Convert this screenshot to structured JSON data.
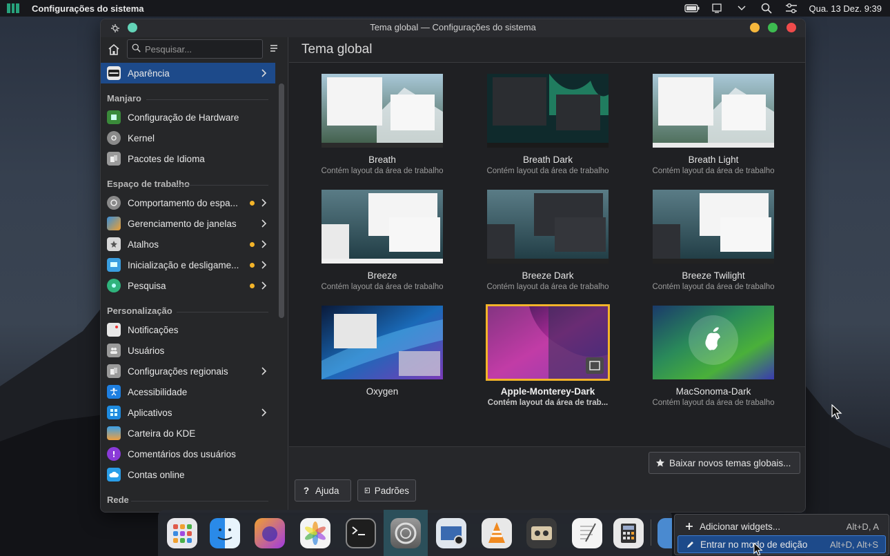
{
  "topbar": {
    "app_name": "Configurações do sistema",
    "clock": "Qua. 13 Dez. 9:39"
  },
  "window": {
    "title": "Tema global — Configurações do sistema"
  },
  "sidebar": {
    "search_placeholder": "Pesquisar...",
    "selected_label": "Aparência",
    "sections": [
      {
        "title": "Manjaro",
        "items": [
          {
            "label": "Configuração de Hardware"
          },
          {
            "label": "Kernel"
          },
          {
            "label": "Pacotes de Idioma"
          }
        ]
      },
      {
        "title": "Espaço de trabalho",
        "items": [
          {
            "label": "Comportamento do espa..."
          },
          {
            "label": "Gerenciamento de janelas"
          },
          {
            "label": "Atalhos"
          },
          {
            "label": "Inicialização e desligame..."
          },
          {
            "label": "Pesquisa"
          }
        ]
      },
      {
        "title": "Personalização",
        "items": [
          {
            "label": "Notificações"
          },
          {
            "label": "Usuários"
          },
          {
            "label": "Configurações regionais"
          },
          {
            "label": "Acessibilidade"
          },
          {
            "label": "Aplicativos"
          },
          {
            "label": "Carteira do KDE"
          },
          {
            "label": "Comentários dos usuários"
          },
          {
            "label": "Contas online"
          }
        ]
      },
      {
        "title": "Rede",
        "items": []
      }
    ]
  },
  "content": {
    "title": "Tema global",
    "themes": [
      {
        "name": "Breath",
        "desc": "Contém layout da área de trabalho"
      },
      {
        "name": "Breath Dark",
        "desc": "Contém layout da área de trabalho"
      },
      {
        "name": "Breath Light",
        "desc": "Contém layout da área de trabalho"
      },
      {
        "name": "Breeze",
        "desc": "Contém layout da área de trabalho"
      },
      {
        "name": "Breeze Dark",
        "desc": "Contém layout da área de trabalho"
      },
      {
        "name": "Breeze Twilight",
        "desc": "Contém layout da área de trabalho"
      },
      {
        "name": "Oxygen",
        "desc": ""
      },
      {
        "name": "Apple-Monterey-Dark",
        "desc": "Contém layout da área de trab..."
      },
      {
        "name": "MacSonoma-Dark",
        "desc": "Contém layout da área de trabalho"
      }
    ],
    "selected_theme": "Apple-Monterey-Dark",
    "get_new_label": "Baixar novos temas globais...",
    "help_label": "Ajuda",
    "defaults_label": "Padrões"
  },
  "context_menu": {
    "items": [
      {
        "label": "Adicionar widgets...",
        "shortcut": "Alt+D, A"
      },
      {
        "label": "Entrar no modo de edição",
        "shortcut": "Alt+D, Alt+S"
      }
    ]
  },
  "colors": {
    "accent": "#1d4a8a",
    "selection_border": "#f3b429",
    "status_dot": "#f3b429"
  }
}
